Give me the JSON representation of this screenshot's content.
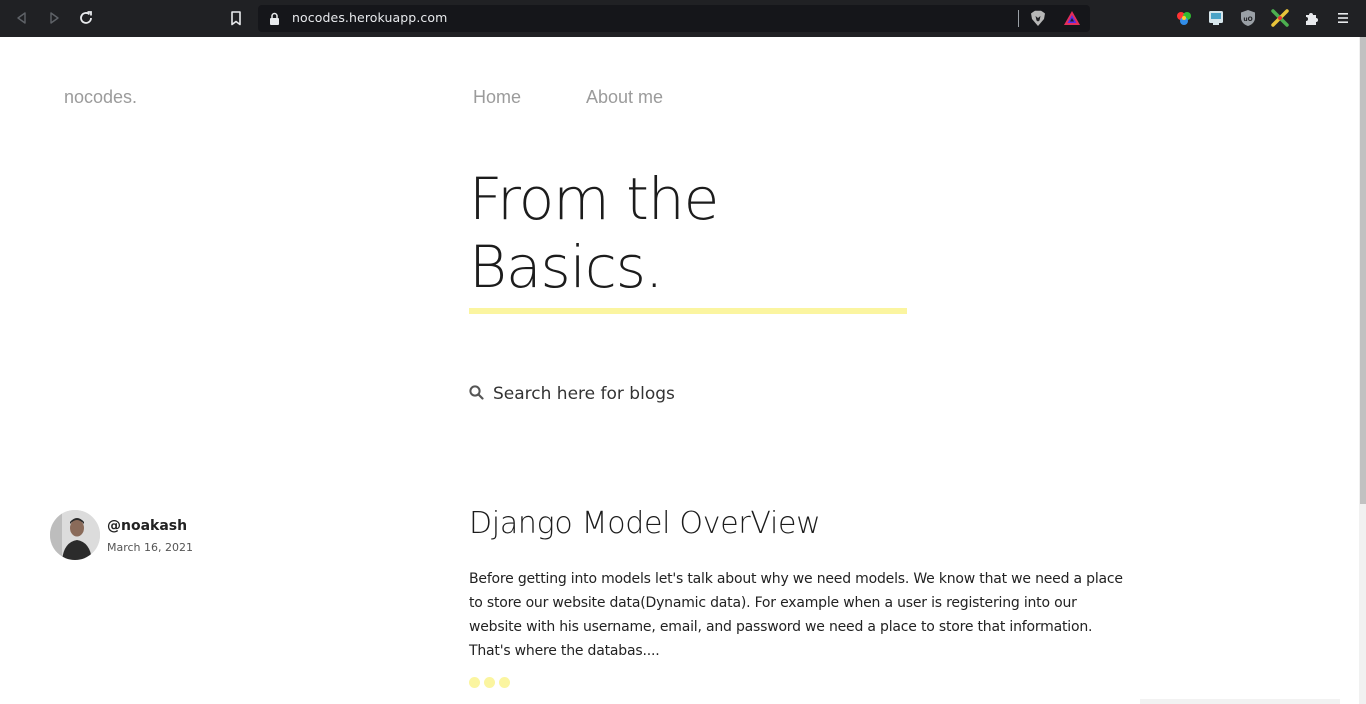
{
  "browser": {
    "url": "nocodes.herokuapp.com",
    "icons": {
      "back": "back-arrow-icon",
      "forward": "forward-arrow-icon",
      "reload": "reload-icon",
      "bookmark": "bookmark-icon",
      "lock": "lock-icon",
      "shields": "brave-shields-icon",
      "rewards": "brave-rewards-icon",
      "extensions": [
        "color-picker-extension-icon",
        "screen-extension-icon",
        "ublock-extension-icon",
        "tools-extension-icon",
        "puzzle-extensions-icon"
      ],
      "menu": "hamburger-menu-icon"
    }
  },
  "site": {
    "logo": "nocodes.",
    "nav": [
      "Home",
      "About me"
    ]
  },
  "hero": {
    "line1": "From the",
    "line2": "Basics.",
    "accent_color": "#fbf5a0"
  },
  "search": {
    "placeholder": "Search here for blogs",
    "icon": "search-icon"
  },
  "post": {
    "author": "@noakash",
    "date": "March 16, 2021",
    "title": "Django Model OverView",
    "excerpt": "Before getting into models let's talk about why we need models. We know that we need a place to store our website data(Dynamic data). For example when a user is registering into our website with his username, email, and password we need a place to store that information. That's where the databas...."
  }
}
